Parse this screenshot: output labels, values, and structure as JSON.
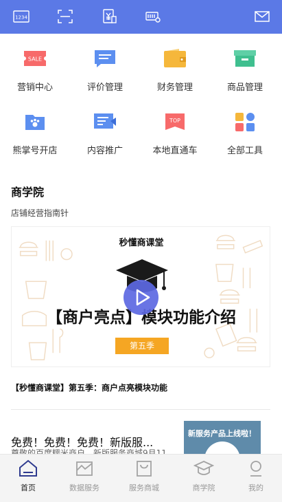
{
  "topbar": {
    "bg_color": "#5b79e6",
    "icons": [
      "keyboard-1234-icon",
      "scan-icon",
      "price-tag-yuan-icon",
      "card-reader-icon",
      "mail-icon"
    ],
    "keyboard_label": "1234"
  },
  "tools": [
    {
      "label": "营销中心",
      "icon": "sale-ticket-icon",
      "icon_text": "SALE",
      "color": "#f76a6a"
    },
    {
      "label": "评价管理",
      "icon": "review-chat-icon",
      "color": "#5c8ff0"
    },
    {
      "label": "财务管理",
      "icon": "wallet-icon",
      "color": "#f5b73b"
    },
    {
      "label": "商品管理",
      "icon": "product-box-icon",
      "color": "#3fbf8f"
    },
    {
      "label": "熊掌号开店",
      "icon": "bear-paw-store-icon",
      "color": "#5c8ff0"
    },
    {
      "label": "内容推广",
      "icon": "content-promote-icon",
      "color": "#5c8ff0"
    },
    {
      "label": "本地直通车",
      "icon": "top-ribbon-icon",
      "icon_text": "TOP",
      "color": "#f76a6a"
    },
    {
      "label": "全部工具",
      "icon": "all-tools-grid-icon",
      "color": "#5c8ff0"
    }
  ],
  "academy": {
    "title": "商学院",
    "subtitle": "店铺经营指南针",
    "video": {
      "brand": "秒懂商课堂",
      "headline": "【商户亮点】模块功能介绍",
      "season": "第五季",
      "caption": "【秒懂商课堂】第五季：商户点亮模块功能"
    }
  },
  "news": {
    "title": "免费！免费！免费！新版服...",
    "subtitle": "尊敬的百度糯米商户，新版服务商城9月11",
    "thumb_text": "新服务产品上线啦！"
  },
  "tabbar": [
    {
      "label": "首页",
      "icon": "home-icon",
      "active": true
    },
    {
      "label": "数据服务",
      "icon": "data-chart-icon",
      "active": false
    },
    {
      "label": "服务商城",
      "icon": "shopping-bag-icon",
      "active": false
    },
    {
      "label": "商学院",
      "icon": "graduation-cap-icon",
      "active": false
    },
    {
      "label": "我的",
      "icon": "profile-icon",
      "active": false
    }
  ]
}
